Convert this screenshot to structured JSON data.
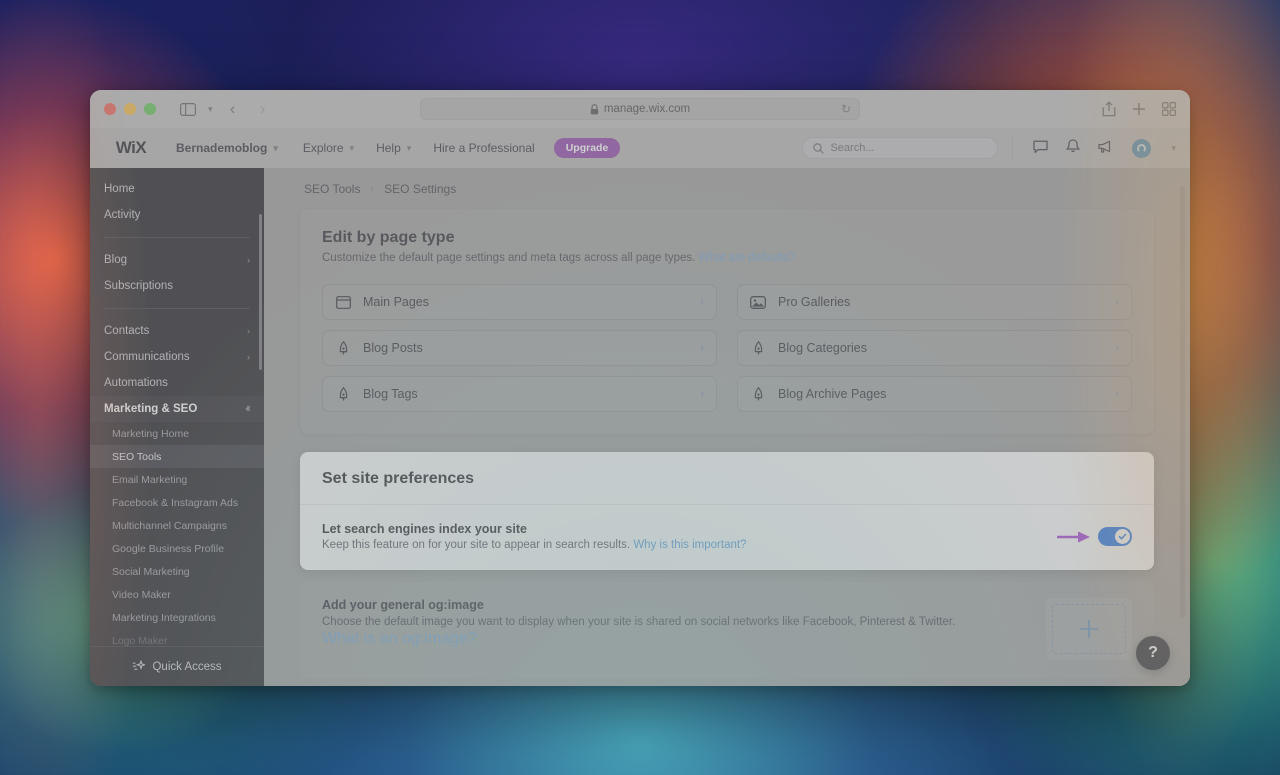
{
  "browser": {
    "url": "manage.wix.com",
    "lock_icon": "lock-icon",
    "traffic_lights": [
      "close",
      "minimize",
      "maximize"
    ],
    "sidebar_toggle_icon": "sidebar-toggle-icon",
    "back_arrow": "‹",
    "forward_arrow": "›",
    "shield_icon": "privacy-shield-icon",
    "reload_icon": "↻",
    "share_icon": "share-icon",
    "new_tab_icon": "+",
    "tab_overview_icon": "tab-overview-icon"
  },
  "topbar": {
    "logo": "WiX",
    "site_name": "Bernademoblog",
    "nav": [
      {
        "label": "Explore",
        "has_chevron": true
      },
      {
        "label": "Help",
        "has_chevron": true
      },
      {
        "label": "Hire a Professional",
        "has_chevron": false
      }
    ],
    "upgrade_label": "Upgrade",
    "upgrade_color": "#8b3fa8",
    "search_placeholder": "Search...",
    "icons": [
      "chat-icon",
      "notifications-bell-icon",
      "announcements-megaphone-icon"
    ],
    "avatar": "user-avatar"
  },
  "sidebar": {
    "items": [
      {
        "label": "Home",
        "chevron": ""
      },
      {
        "label": "Activity",
        "chevron": ""
      },
      {
        "divider": true
      },
      {
        "label": "Blog",
        "chevron": "›"
      },
      {
        "label": "Subscriptions",
        "chevron": ""
      },
      {
        "divider": true
      },
      {
        "label": "Contacts",
        "chevron": "›"
      },
      {
        "label": "Communications",
        "chevron": "›"
      },
      {
        "label": "Automations",
        "chevron": ""
      },
      {
        "label": "Marketing & SEO",
        "chevron": "ⱏ",
        "expanded": true
      }
    ],
    "marketing_submenu": [
      {
        "label": "Marketing Home",
        "selected": false
      },
      {
        "label": "SEO Tools",
        "selected": true
      },
      {
        "label": "Email Marketing",
        "selected": false
      },
      {
        "label": "Facebook & Instagram Ads",
        "selected": false
      },
      {
        "label": "Multichannel Campaigns",
        "selected": false
      },
      {
        "label": "Google Business Profile",
        "selected": false
      },
      {
        "label": "Social Marketing",
        "selected": false
      },
      {
        "label": "Video Maker",
        "selected": false
      },
      {
        "label": "Marketing Integrations",
        "selected": false
      },
      {
        "label": "Logo Maker",
        "selected": false,
        "faded": true
      }
    ],
    "quick_access_label": "Quick Access",
    "quick_access_icon": "sparkle-star-icon"
  },
  "breadcrumb": {
    "items": [
      "SEO Tools",
      "SEO Settings"
    ],
    "separator": "›"
  },
  "edit_by_page_type": {
    "title": "Edit by page type",
    "subtitle": "Customize the default page settings and meta tags across all page types.",
    "link_label": "What are defaults?",
    "rows": [
      {
        "label": "Main Pages",
        "icon": "browser-window-icon"
      },
      {
        "label": "Pro Galleries",
        "icon": "image-gallery-icon"
      },
      {
        "label": "Blog Posts",
        "icon": "pen-nib-icon"
      },
      {
        "label": "Blog Categories",
        "icon": "pen-nib-icon"
      },
      {
        "label": "Blog Tags",
        "icon": "pen-nib-icon"
      },
      {
        "label": "Blog Archive Pages",
        "icon": "pen-nib-icon"
      }
    ],
    "row_chevron": "›"
  },
  "site_preferences": {
    "title": "Set site preferences",
    "index_row": {
      "title": "Let search engines index your site",
      "subtitle": "Keep this feature on for your site to appear in search results.",
      "link_label": "Why is this important?",
      "toggle_state": "on",
      "toggle_color": "#1a6fe8",
      "annotation_arrow_color": "#a23bd4"
    }
  },
  "og_image": {
    "title": "Add your general og:image",
    "subtitle": "Choose the default image you want to display when your site is shared on social networks like Facebook, Pinterest & Twitter.",
    "link_label": "What is an og:image?",
    "dropzone_icon": "plus-icon"
  },
  "help_button": {
    "label": "?"
  }
}
